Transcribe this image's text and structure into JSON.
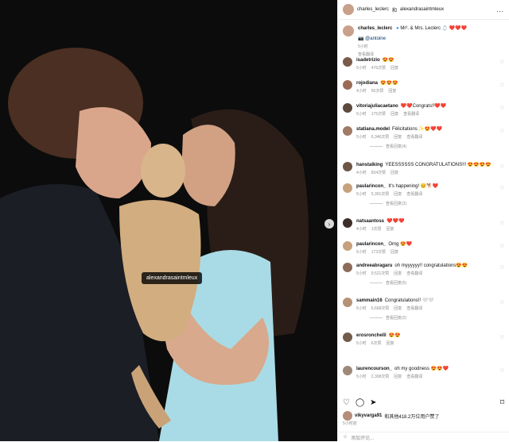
{
  "photo": {
    "tag": "alexandrasaintmleux"
  },
  "header": {
    "username": "charles_leclerc",
    "separator": "和",
    "collaborator": "alexandrasaintmleux"
  },
  "caption": {
    "username": "charles_leclerc",
    "text": "Mr². & Mrs. Leclerc 💍 ❤️❤️❤️",
    "mention": "📷 @antoine",
    "time": "5小时",
    "translate": "查看翻译"
  },
  "comments": [
    {
      "user": "isadetrizio",
      "text": "😍😍",
      "time": "5小时",
      "likes": "476次赞",
      "reply": "回复"
    },
    {
      "user": "rojodiana",
      "text": "😍😍😍",
      "time": "4小时",
      "likes": "55次赞",
      "reply": "回复"
    },
    {
      "user": "vitoriajuliacaetano",
      "text": "❤️❤️Congrats!!❤️❤️",
      "time": "5小时",
      "likes": "175次赞",
      "reply": "回复",
      "translate": "查看翻译"
    },
    {
      "user": "statiana.model",
      "text": "Félicitations ✨😍❤️❤️",
      "time": "5小时",
      "likes": "6,346次赞",
      "reply": "回复",
      "translate": "查看翻译",
      "view": "查看回复(4)"
    },
    {
      "user": "hanstalking",
      "text": "YEESSSSSS CONGRATULATIONS!!! 😍😍😍😍",
      "time": "4小时",
      "likes": "834次赞",
      "reply": "回复"
    },
    {
      "user": "paularincon_",
      "text": "It's happening! 😊🐕❤️",
      "time": "5小时",
      "likes": "5,391次赞",
      "reply": "回复",
      "translate": "查看翻译",
      "view": "查看回复(3)"
    },
    {
      "user": "natsaantoss",
      "text": "❤️❤️❤️",
      "time": "4小时",
      "likes": "1次赞",
      "reply": "回复"
    },
    {
      "user": "paularincon_",
      "text": "Omg 😍❤️",
      "time": "5小时",
      "likes": "173次赞",
      "reply": "回复"
    },
    {
      "user": "andreeabragaru",
      "text": "oh myyyyyy!! congratulations😍😍",
      "time": "5小时",
      "likes": "9,521次赞",
      "reply": "回复",
      "translate": "查看翻译",
      "view": "查看回复(5)"
    },
    {
      "user": "sammain16",
      "text": "Congratulations!! 🤍🤍",
      "time": "5小时",
      "likes": "5,668次赞",
      "reply": "回复",
      "translate": "查看翻译",
      "view": "查看回复(2)"
    },
    {
      "user": "erosronchelli",
      "text": "😍😍",
      "time": "5小时",
      "likes": "6次赞",
      "reply": "回复"
    },
    {
      "user": "laurencourson_",
      "text": "oh my goodness 😍😍❤️",
      "time": "5小时",
      "likes": "2,308次赞",
      "reply": "回复",
      "translate": "查看翻译"
    }
  ],
  "footer": {
    "likes_user": "vikyvarga91",
    "likes_text": "和其他418.2万位用户赞了",
    "time": "5小时前",
    "add_comment": "添加评论..."
  }
}
